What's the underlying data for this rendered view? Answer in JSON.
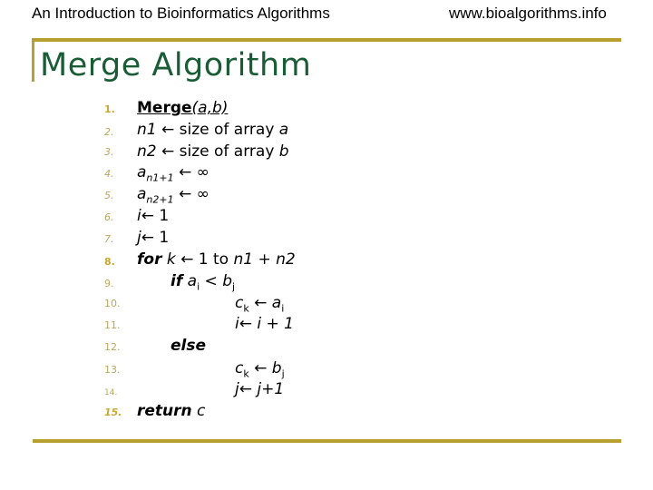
{
  "header": {
    "left": "An Introduction to Bioinformatics Algorithms",
    "right": "www.bioalgorithms.info"
  },
  "title": "Merge Algorithm",
  "colors": {
    "accent": "#b8a030",
    "title": "#1a5c36"
  },
  "lines": [
    {
      "num": "1.",
      "name": "Merge",
      "args": "(a,b)"
    },
    {
      "num": "2.",
      "lhs": "n1",
      "arrow": "←",
      "rhs": "size of array",
      "var": "a"
    },
    {
      "num": "3.",
      "lhs": "n2",
      "arrow": "←",
      "rhs": "size of array",
      "var": "b"
    },
    {
      "num": "4.",
      "lhs": "a",
      "sub": "n1+1",
      "arrow": "←",
      "rhs": "∞"
    },
    {
      "num": "5.",
      "lhs": "a",
      "sub": "n2+1",
      "arrow": "←",
      "rhs": "∞"
    },
    {
      "num": "6.",
      "lhs": "i",
      "arrow": "←",
      "rhs": "1"
    },
    {
      "num": "7.",
      "lhs": "j",
      "arrow": "←",
      "rhs": "1"
    },
    {
      "num": "8.",
      "kw": "for",
      "lhs": "k",
      "arrow": "←",
      "rhs": "1 to",
      "tail": "n1 + n2"
    },
    {
      "num": "9.",
      "kw": "if",
      "lhs": "a",
      "sub": "i",
      "op": "<",
      "rhs": "b",
      "rsub": "j"
    },
    {
      "num": "10.",
      "lhs": "c",
      "sub": "k",
      "arrow": "←",
      "rhs": "a",
      "rsub": "i"
    },
    {
      "num": "11.",
      "lhs": "i",
      "arrow": "←",
      "rhs": "i + 1"
    },
    {
      "num": "12.",
      "kw": "else"
    },
    {
      "num": "13.",
      "lhs": "c",
      "sub": "k",
      "arrow": "←",
      "rhs": "b",
      "rsub": "j"
    },
    {
      "num": "14.",
      "lhs": "j",
      "arrow": "←",
      "rhs": "j+1"
    },
    {
      "num": "15.",
      "kw": "return",
      "rhs": "c"
    }
  ]
}
